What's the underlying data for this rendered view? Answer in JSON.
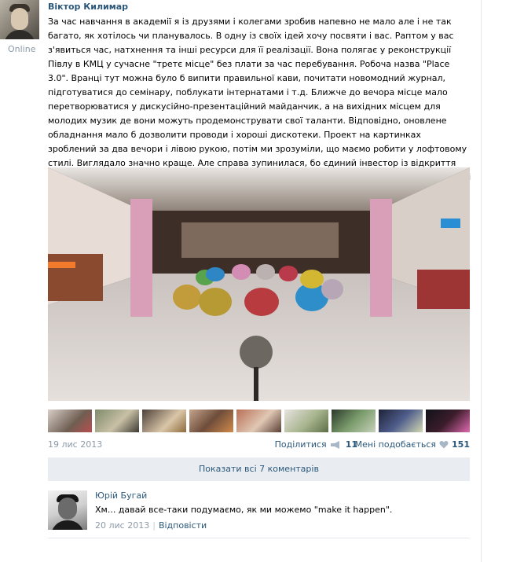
{
  "post": {
    "author": "Віктор Килимар",
    "status": "Online",
    "text": "За час навчання в академії я із друзями і колегами зробив напевно не мало але і не так багато, як хотілось чи планувалось. В одну із своїх ідей хочу посвяти і вас. Раптом у вас з'явиться час, натхнення та інші ресурси для її реалізації. Вона полягає у реконструкції Півлу в КМЦ у сучасне \"третє місце\" без плати за час перебування. Робоча назва \"Place 3.0\". Вранці тут можна було б випити правильної кави, почитати новомодний журнал, підготуватися до семінару, поблукати інтернатами і т.д. Ближче до вечора місце мало перетворюватися у дискусійно-презентаційний майданчик, а на вихідних місцем для молодих музик де вони можуть продемонструвати свої таланти. Відповідно, оновлене обладнання мало б дозволити проводи і хороші дискотеки. Проект на картинках зроблений за два вечори і лівою рукою, потім ми зрозуміли, що маємо робити у лофтовому стилі. Виглядало значно краще. Але справа зупинилася, бо єдиний інвестор із відкриття фройда відмовився від ідеї. Тому ідея жила у розмовах на кухні та десятках мейлів. Нехай і тут поживе тепер :)",
    "date": "19 лис 2013",
    "share_label": "Поділитися",
    "share_count": "11",
    "like_label": "Мені подобається",
    "like_count": "151",
    "thumb_count": 9,
    "icons": {
      "share": "megaphone-icon",
      "like": "heart-icon"
    }
  },
  "comments_bar": {
    "label": "Показати всі 7 коментарів"
  },
  "comment": {
    "author": "Юрій Бугай",
    "text": "Хм... давай все-таки подумаємо, як ми можемо \"make it happen\".",
    "date": "20 лис 2013",
    "reply_label": "Відповісти"
  },
  "colors": {
    "link": "#2b587a",
    "muted": "#8c9aa8",
    "bar_bg": "#e9edf1"
  }
}
